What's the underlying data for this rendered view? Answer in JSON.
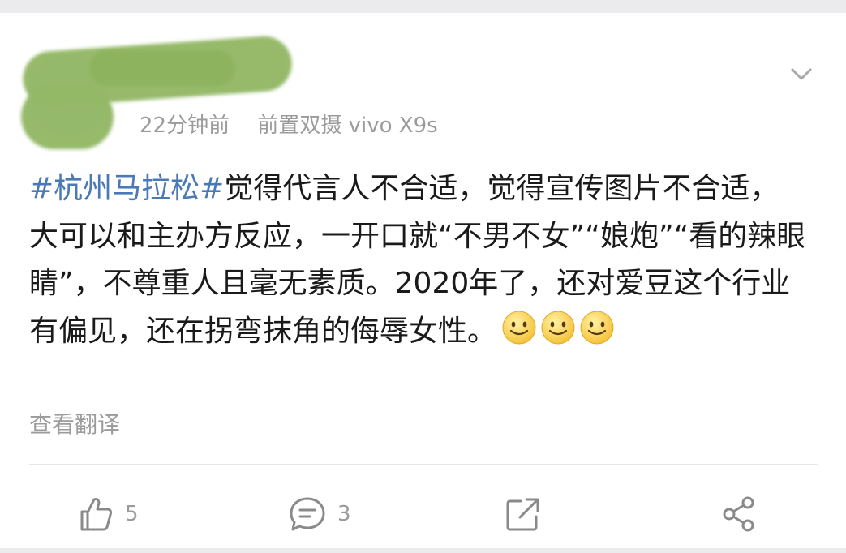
{
  "post": {
    "author": {
      "avatar_icon": "avatar-image",
      "name_obscured": true
    },
    "meta": {
      "time": "22分钟前",
      "source": "前置双摄 vivo X9s"
    },
    "menu_icon": "chevron-down-icon",
    "text": {
      "topic": "#杭州马拉松#",
      "body": "觉得代言人不合适，觉得宣传图片不合适，大可以和主办方反应，一开口就“不男不女”“娘炮”“看的辣眼睛”，不尊重人且毫无素质。2020年了，还对爱豆这个行业有偏见，还在拐弯抹角的侮辱女性。",
      "emojis": [
        "smile-emoji",
        "smile-emoji",
        "smile-emoji"
      ]
    },
    "translate_label": "查看翻译"
  },
  "actions": {
    "like": {
      "icon": "thumbs-up-icon",
      "count": "5"
    },
    "comment": {
      "icon": "comment-icon",
      "count": "3"
    },
    "repost": {
      "icon": "repost-icon"
    },
    "share": {
      "icon": "share-icon"
    }
  },
  "colors": {
    "topic": "#4b79b5",
    "meta": "#9b9b9b",
    "text": "#1a1a1a",
    "icon": "#8a8a8a",
    "obscure": "#93b866"
  }
}
